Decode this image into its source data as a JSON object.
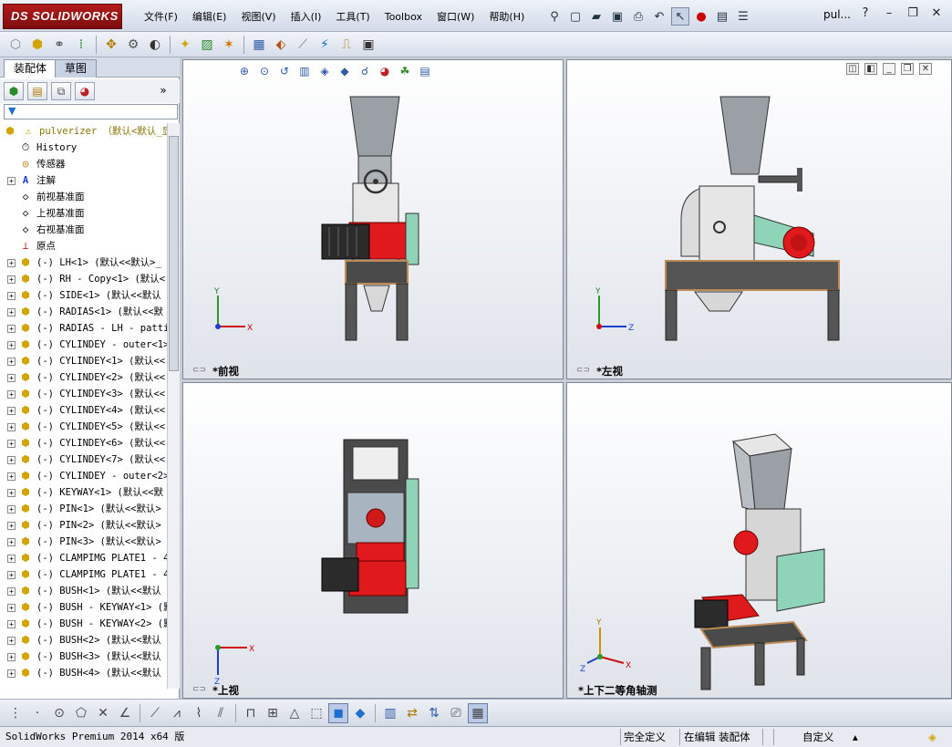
{
  "app": {
    "brand": "SOLIDWORKS",
    "brand_prefix": "DS",
    "doc_title": "pul..."
  },
  "menu": [
    "文件(F)",
    "编辑(E)",
    "视图(V)",
    "插入(I)",
    "工具(T)",
    "Toolbox",
    "窗口(W)",
    "帮助(H)"
  ],
  "panel": {
    "tabs": [
      "装配体",
      "草图"
    ],
    "active_tab": 0,
    "root": "pulverizer （默认<默认_显",
    "items": [
      {
        "label": "History",
        "icon": "history-icon",
        "expand": false
      },
      {
        "label": "传感器",
        "icon": "sensor-icon",
        "expand": false
      },
      {
        "label": "注解",
        "icon": "annotation-icon",
        "expand": true
      },
      {
        "label": "前视基准面",
        "icon": "plane-icon",
        "expand": false
      },
      {
        "label": "上视基准面",
        "icon": "plane-icon",
        "expand": false
      },
      {
        "label": "右视基准面",
        "icon": "plane-icon",
        "expand": false
      },
      {
        "label": "原点",
        "icon": "origin-icon",
        "expand": false
      },
      {
        "label": "(-) LH<1> (默认<<默认>_",
        "icon": "part-icon",
        "expand": true
      },
      {
        "label": "(-) RH - Copy<1> (默认<",
        "icon": "part-icon",
        "expand": true
      },
      {
        "label": "(-) SIDE<1> (默认<<默认",
        "icon": "part-icon",
        "expand": true
      },
      {
        "label": "(-) RADIAS<1> (默认<<默",
        "icon": "part-icon",
        "expand": true
      },
      {
        "label": "(-) RADIAS - LH - patti",
        "icon": "part-icon",
        "expand": true
      },
      {
        "label": "(-) CYLINDEY - outer<1>",
        "icon": "part-icon",
        "expand": true
      },
      {
        "label": "(-) CYLINDEY<1> (默认<<",
        "icon": "part-icon",
        "expand": true
      },
      {
        "label": "(-) CYLINDEY<2> (默认<<",
        "icon": "part-icon",
        "expand": true
      },
      {
        "label": "(-) CYLINDEY<3> (默认<<",
        "icon": "part-icon",
        "expand": true
      },
      {
        "label": "(-) CYLINDEY<4> (默认<<",
        "icon": "part-icon",
        "expand": true
      },
      {
        "label": "(-) CYLINDEY<5> (默认<<",
        "icon": "part-icon",
        "expand": true
      },
      {
        "label": "(-) CYLINDEY<6> (默认<<",
        "icon": "part-icon",
        "expand": true
      },
      {
        "label": "(-) CYLINDEY<7> (默认<<",
        "icon": "part-icon",
        "expand": true
      },
      {
        "label": "(-) CYLINDEY - outer<2>",
        "icon": "part-icon",
        "expand": true
      },
      {
        "label": "(-) KEYWAY<1> (默认<<默",
        "icon": "part-icon",
        "expand": true
      },
      {
        "label": "(-) PIN<1> (默认<<默认>",
        "icon": "part-icon",
        "expand": true
      },
      {
        "label": "(-) PIN<2> (默认<<默认>",
        "icon": "part-icon",
        "expand": true
      },
      {
        "label": "(-) PIN<3> (默认<<默认>",
        "icon": "part-icon",
        "expand": true
      },
      {
        "label": "(-) CLAMPIMG PLATE1 - 4",
        "icon": "part-icon",
        "expand": true
      },
      {
        "label": "(-) CLAMPIMG PLATE1 - 4",
        "icon": "part-icon",
        "expand": true
      },
      {
        "label": "(-) BUSH<1> (默认<<默认",
        "icon": "part-icon",
        "expand": true
      },
      {
        "label": "(-) BUSH - KEYWAY<1> (默",
        "icon": "part-icon",
        "expand": true
      },
      {
        "label": "(-) BUSH - KEYWAY<2> (默",
        "icon": "part-icon",
        "expand": true
      },
      {
        "label": "(-) BUSH<2> (默认<<默认",
        "icon": "part-icon",
        "expand": true
      },
      {
        "label": "(-) BUSH<3> (默认<<默认",
        "icon": "part-icon",
        "expand": true
      },
      {
        "label": "(-) BUSH<4> (默认<<默认",
        "icon": "part-icon",
        "expand": true
      }
    ]
  },
  "viewports": {
    "front": {
      "label": "*前视",
      "axes": [
        "Y",
        "X"
      ]
    },
    "left": {
      "label": "*左视",
      "axes": [
        "Y",
        "Z"
      ]
    },
    "top": {
      "label": "*上视",
      "axes": [
        "X",
        "Z"
      ]
    },
    "iso": {
      "label": "*上下二等角轴测",
      "axes": [
        "Y",
        "Z",
        "X"
      ]
    }
  },
  "status": {
    "version": "SolidWorks Premium 2014 x64 版",
    "definition": "完全定义",
    "editing": "在编辑 装配体",
    "units": "自定义"
  },
  "colors": {
    "brand": "#a81717",
    "motor_red": "#e0191c",
    "belt_guard": "#8fd3b8",
    "frame": "#4a4a4a",
    "base_plate": "#bb8a55"
  }
}
